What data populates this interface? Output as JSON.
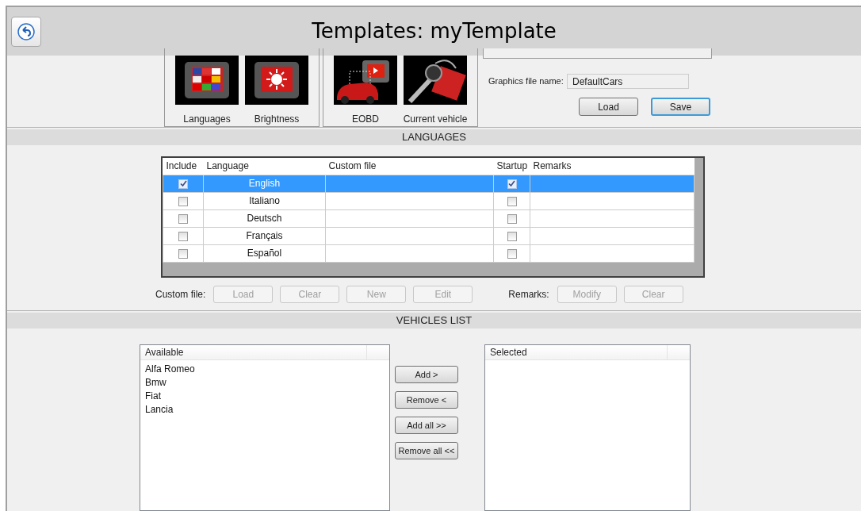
{
  "window": {
    "title": "Templates: myTemplate"
  },
  "tile_groups": [
    {
      "tiles": [
        {
          "label": "Languages",
          "kind": "flags"
        },
        {
          "label": "Brightness",
          "kind": "sun"
        }
      ]
    },
    {
      "tiles": [
        {
          "label": "EOBD",
          "kind": "car"
        },
        {
          "label": "Current vehicle",
          "kind": "key"
        }
      ]
    }
  ],
  "graphics_file": {
    "label": "Graphics file name:",
    "value": "DefaultCars"
  },
  "file_buttons": [
    {
      "label": "Load",
      "focused": false
    },
    {
      "label": "Save",
      "focused": true
    }
  ],
  "languages": {
    "title": "LANGUAGES",
    "columns": [
      "Include",
      "Language",
      "Custom file",
      "Startup",
      "Remarks"
    ],
    "rows": [
      {
        "include": true,
        "language": "English",
        "startup": true,
        "selected": true
      },
      {
        "include": false,
        "language": "Italiano",
        "startup": false,
        "selected": false
      },
      {
        "include": false,
        "language": "Deutsch",
        "startup": false,
        "selected": false
      },
      {
        "include": false,
        "language": "Français",
        "startup": false,
        "selected": false
      },
      {
        "include": false,
        "language": "Español",
        "startup": false,
        "selected": false
      }
    ]
  },
  "custom_file": {
    "label": "Custom file:",
    "buttons": [
      {
        "label": "Load",
        "disabled": true
      },
      {
        "label": "Clear",
        "disabled": true
      },
      {
        "label": "New",
        "disabled": true
      },
      {
        "label": "Edit",
        "disabled": true
      }
    ]
  },
  "remarks": {
    "label": "Remarks:",
    "buttons": [
      {
        "label": "Modify",
        "disabled": true
      },
      {
        "label": "Clear",
        "disabled": true
      }
    ]
  },
  "vehicles": {
    "title": "VEHICLES LIST",
    "available": {
      "header": "Available",
      "items": [
        "Alfa Romeo",
        "Bmw",
        "Fiat",
        "Lancia"
      ]
    },
    "buttons": [
      {
        "label": "Add >"
      },
      {
        "label": "Remove <"
      },
      {
        "label": "Add all >>"
      },
      {
        "label": "Remove all <<"
      }
    ],
    "selected": {
      "header": "Selected"
    }
  }
}
